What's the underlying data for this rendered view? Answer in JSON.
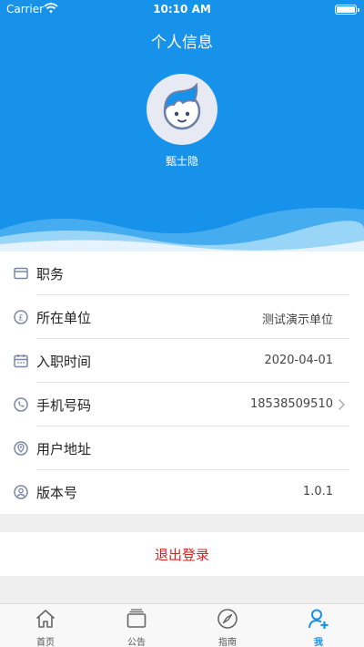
{
  "status_bar": {
    "carrier": "Carrier",
    "time": "10:10 AM"
  },
  "header": {
    "title": "个人信息",
    "user_name": "甄士隐"
  },
  "colors": {
    "accent": "#1692eb",
    "logout": "#e02020",
    "icon": "#7b86a8"
  },
  "info": {
    "rows": [
      {
        "icon": "card-icon",
        "label": "职务",
        "value": ""
      },
      {
        "icon": "unit-icon",
        "label": "所在单位",
        "value": "测试演示单位"
      },
      {
        "icon": "calendar-icon",
        "label": "入职时间",
        "value": "2020-04-01"
      },
      {
        "icon": "phone-icon",
        "label": "手机号码",
        "value": "18538509510"
      },
      {
        "icon": "location-icon",
        "label": "用户地址",
        "value": ""
      },
      {
        "icon": "user-icon",
        "label": "版本号",
        "value": "1.0.1"
      }
    ]
  },
  "logout": {
    "label": "退出登录"
  },
  "tabbar": {
    "tabs": [
      {
        "icon": "home-icon",
        "label": "首页"
      },
      {
        "icon": "notice-icon",
        "label": "公告"
      },
      {
        "icon": "compass-icon",
        "label": "指南"
      },
      {
        "icon": "profile-add-icon",
        "label": "我",
        "active": true
      }
    ]
  }
}
